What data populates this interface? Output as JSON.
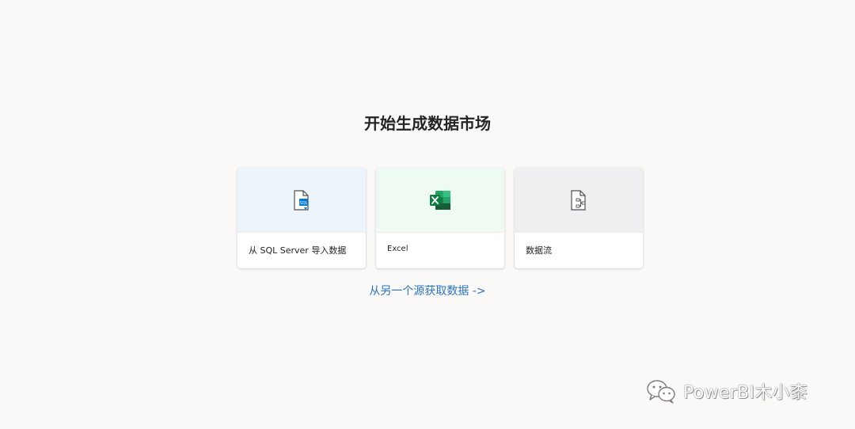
{
  "main": {
    "title": "开始生成数据市场",
    "cards": [
      {
        "label": "从 SQL Server 导入数据",
        "icon": "sql-file-icon"
      },
      {
        "label": "Excel",
        "icon": "excel-icon"
      },
      {
        "label": "数据流",
        "icon": "dataflow-file-icon"
      }
    ],
    "other_source_link": "从另一个源获取数据 ->"
  },
  "watermark": {
    "text": "PowerBI木小桼",
    "icon": "wechat-icon"
  },
  "colors": {
    "background": "#faf9f8",
    "link": "#2b73c6",
    "excel_green": "#107c41",
    "sql_blue": "#0078d4"
  }
}
